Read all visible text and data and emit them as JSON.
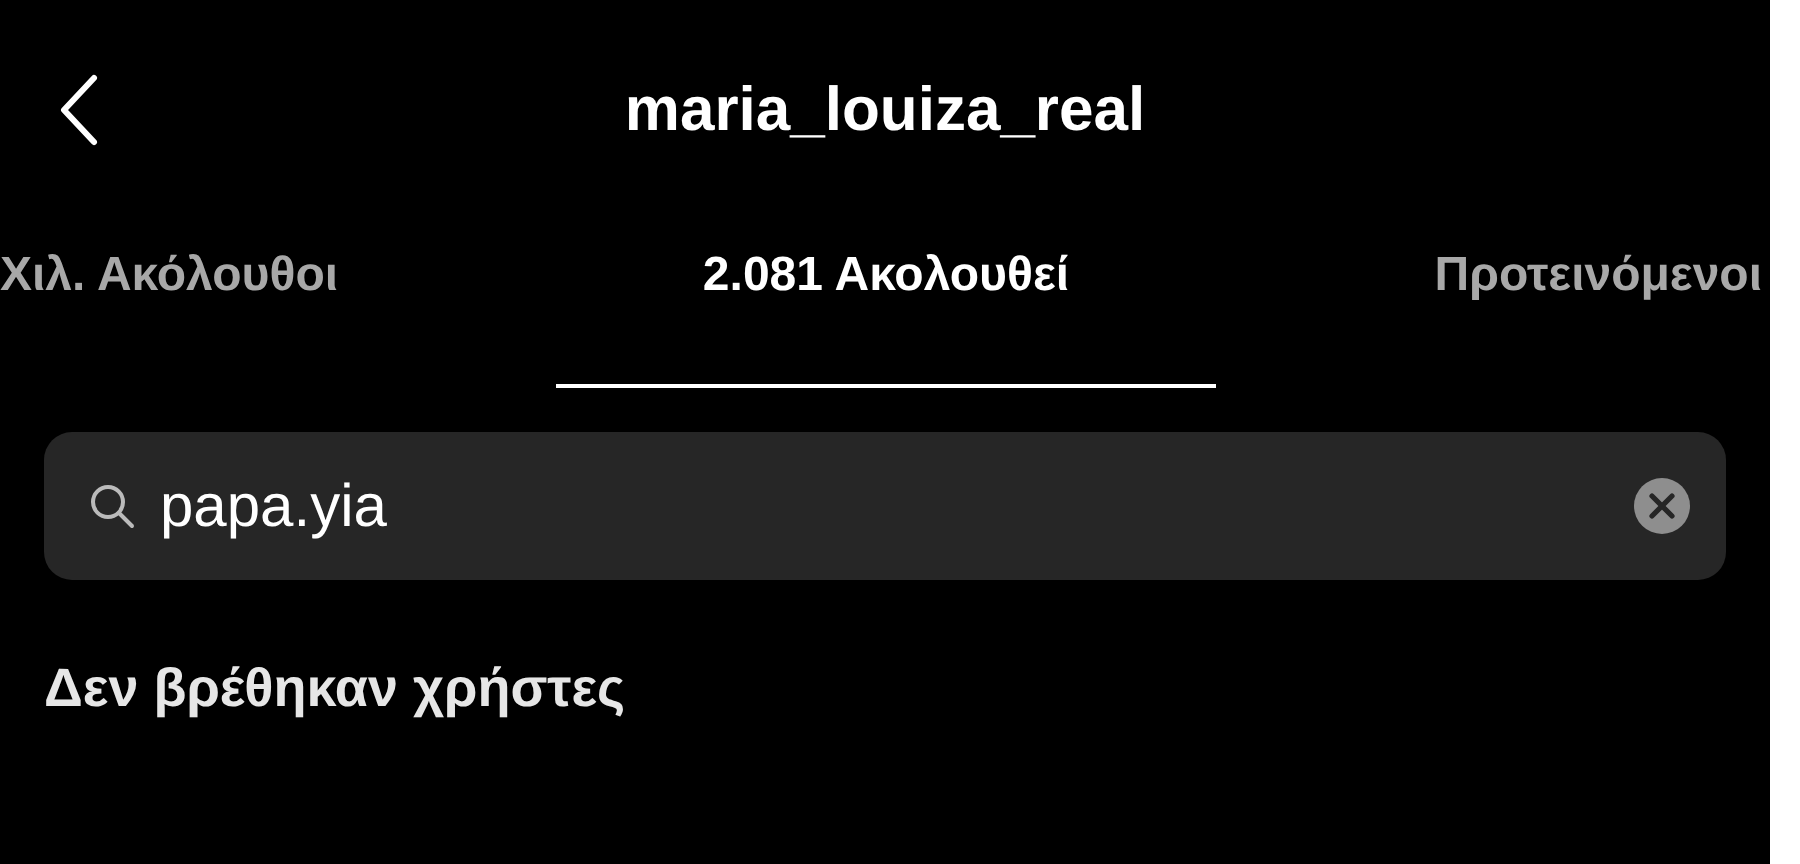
{
  "header": {
    "back": true,
    "title": "maria_louiza_real"
  },
  "tabs": [
    {
      "label": "Χιλ. Ακόλουθοι",
      "selected": false
    },
    {
      "label": "2.081 Ακολουθεί",
      "selected": true
    },
    {
      "label": "Προτεινόμενοι",
      "selected": false
    }
  ],
  "search": {
    "value": "papa.yia"
  },
  "message": "Δεν βρέθηκαν χρήστες"
}
